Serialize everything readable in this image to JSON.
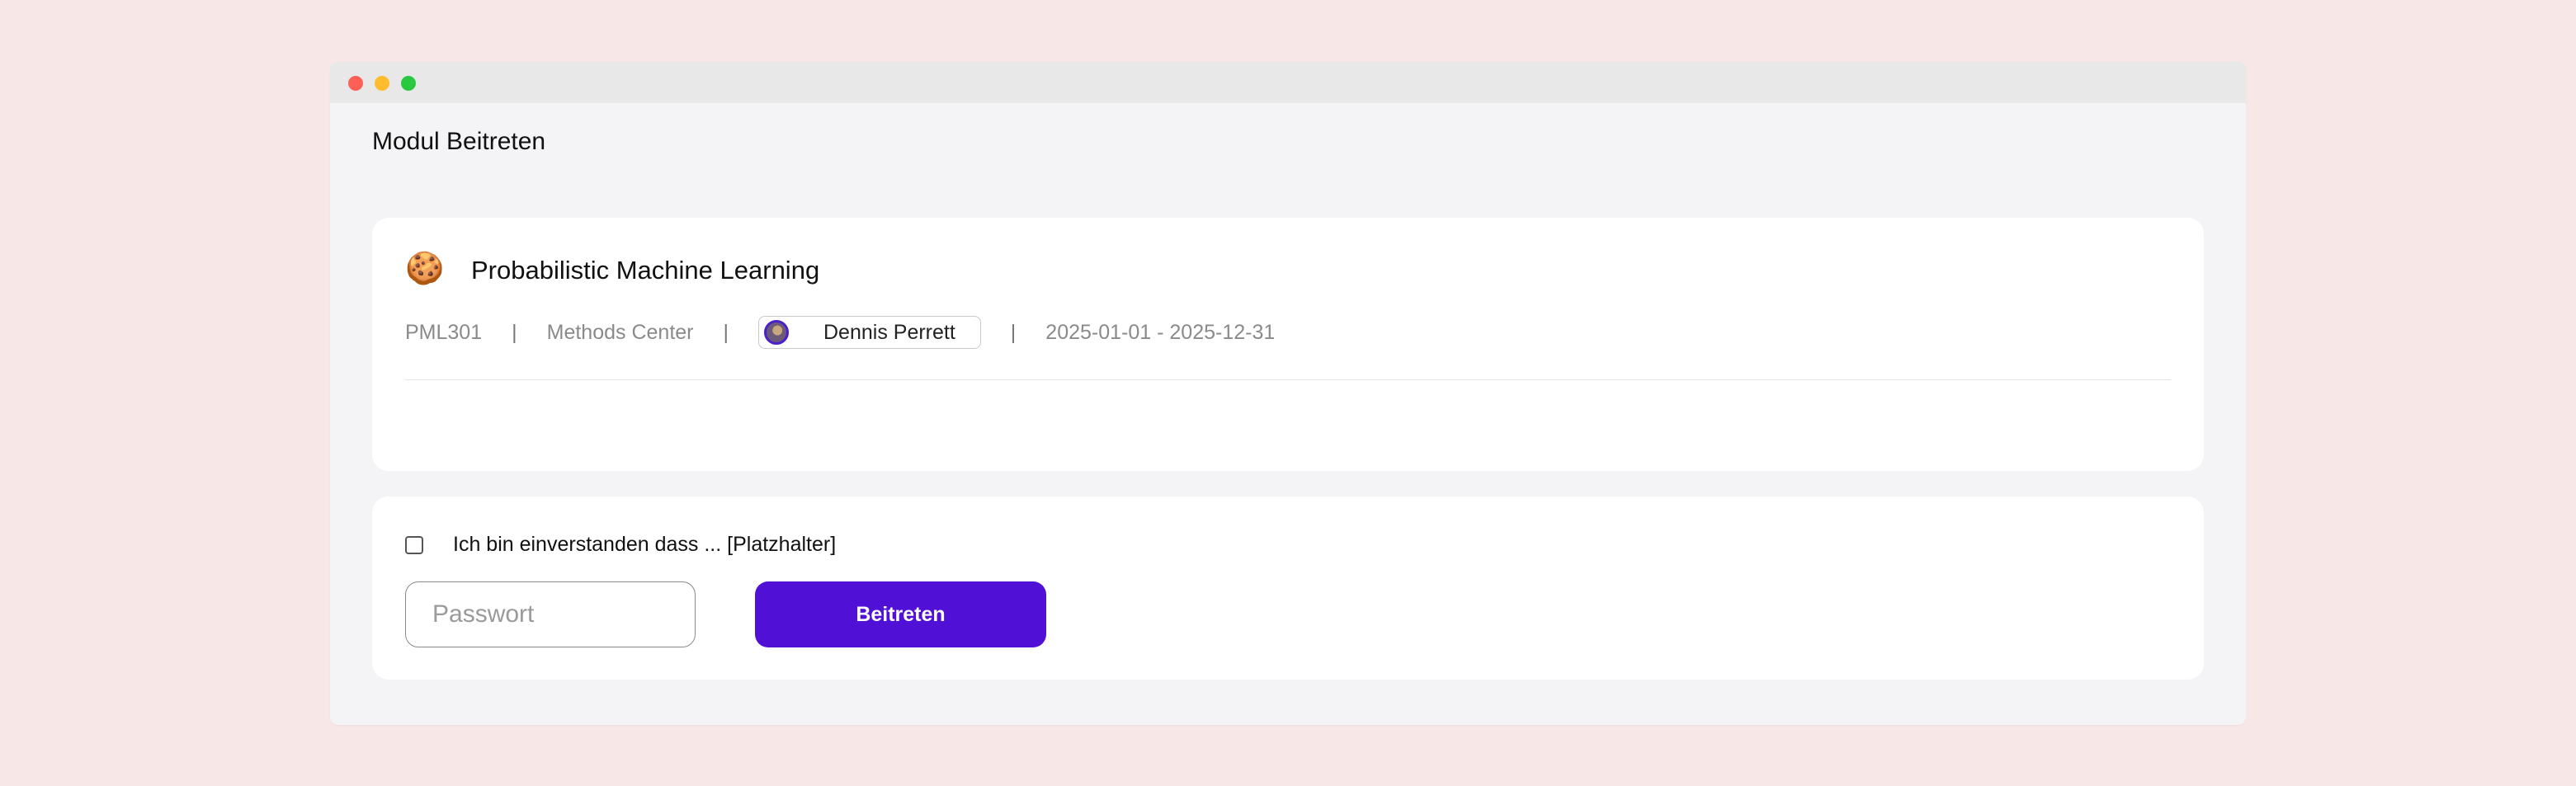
{
  "window": {
    "title": "Modul Beitreten"
  },
  "module": {
    "icon": "cookie-emoji",
    "emoji": "🍪",
    "name": "Probabilistic Machine Learning",
    "code": "PML301",
    "department": "Methods Center",
    "owner": "Dennis Perrett",
    "period": "2025-01-01 - 2025-12-31"
  },
  "join": {
    "consent_label": "Ich bin einverstanden dass ... [Platzhalter]",
    "password_placeholder": "Passwort",
    "password_value": "",
    "button_label": "Beitreten"
  },
  "colors": {
    "page_background": "#f7e8e7",
    "window_background": "#f4f4f6",
    "titlebar": "#e8e8e8",
    "primary": "#5010d6"
  }
}
